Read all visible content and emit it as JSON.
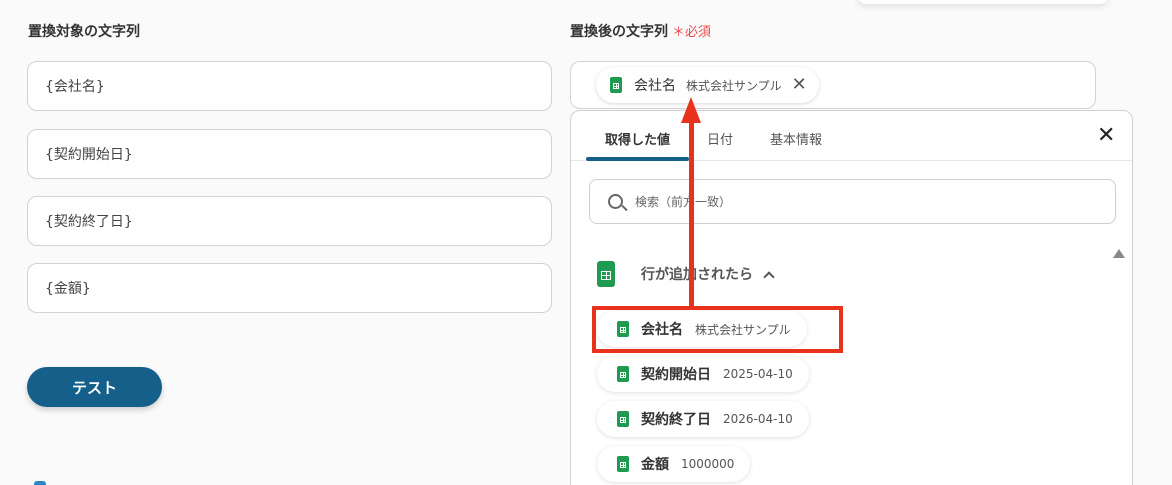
{
  "left": {
    "label": "置換対象の文字列",
    "fields": [
      "{会社名}",
      "{契約開始日}",
      "{契約終了日}",
      "{金額}"
    ],
    "test_button": "テスト"
  },
  "right": {
    "label": "置換後の文字列",
    "required_mark": "＊必須",
    "chip": {
      "name": "会社名",
      "value": "株式会社サンプル",
      "close": "✕"
    }
  },
  "panel": {
    "tabs": [
      "取得した値",
      "日付",
      "基本情報"
    ],
    "close": "✕",
    "search_placeholder": "検索（前方一致）",
    "group_title": "行が追加されたら",
    "items": [
      {
        "name": "会社名",
        "value": "株式会社サンプル"
      },
      {
        "name": "契約開始日",
        "value": "2025-04-10"
      },
      {
        "name": "契約終了日",
        "value": "2026-04-10"
      },
      {
        "name": "金額",
        "value": "1000000"
      }
    ]
  },
  "colors": {
    "accent": "#15608a",
    "highlight": "#e8321c",
    "sheet_green": "#1e9a51",
    "required": "#e84a4a"
  }
}
